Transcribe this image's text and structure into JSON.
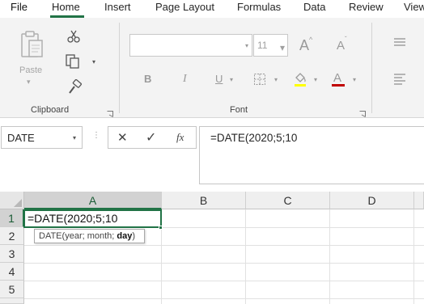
{
  "tabs": {
    "file": "File",
    "home": "Home",
    "insert": "Insert",
    "page_layout": "Page Layout",
    "formulas": "Formulas",
    "data": "Data",
    "review": "Review",
    "view": "View"
  },
  "ribbon": {
    "clipboard": {
      "label": "Clipboard",
      "paste_label": "Paste",
      "icons": [
        "paste-icon",
        "cut-icon",
        "copy-icon",
        "format-painter-icon"
      ]
    },
    "font": {
      "label": "Font",
      "font_name": "",
      "font_size": "11",
      "bold_glyph": "B",
      "italic_glyph": "I",
      "underline_glyph": "U",
      "font_color_glyph": "A",
      "grow_glyph": "A",
      "shrink_glyph": "A",
      "font_color": "#c00000",
      "highlight_color": "#ffff00"
    },
    "alignment": {
      "icons": [
        "align-top-icon",
        "align-left-icon"
      ]
    }
  },
  "formula_bar": {
    "name_box": "DATE",
    "formula": "=DATE(2020;5;10",
    "cancel_glyph": "✕",
    "enter_glyph": "✓",
    "fx_glyph": "fx"
  },
  "grid": {
    "columns": [
      "A",
      "B",
      "C",
      "D"
    ],
    "rows": [
      "1",
      "2",
      "3",
      "4",
      "5"
    ],
    "active_cell": {
      "ref": "A1",
      "value": "=DATE(2020;5;10"
    },
    "tooltip": {
      "fn": "DATE",
      "open": "(",
      "args": "year; month; ",
      "current_arg": "day",
      "close": ")"
    }
  },
  "colors": {
    "accent": "#217346",
    "ribbon_bg": "#f3f3f3"
  }
}
